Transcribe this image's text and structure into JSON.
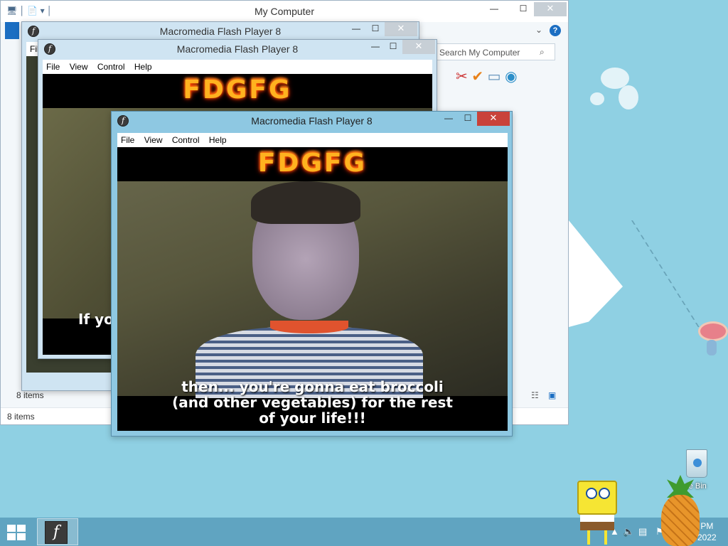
{
  "explorer": {
    "title": "My Computer",
    "search_placeholder": "Search My Computer",
    "status_back": "8 items",
    "status_front": "8 items",
    "nav_label": "Fil"
  },
  "flash_windows": [
    {
      "title": "Macromedia Flash Player 8"
    },
    {
      "title": "Macromedia Flash Player 8",
      "subtitle": "If yo"
    },
    {
      "title": "Macromedia Flash Player 8",
      "subtitle": [
        "then... you're gonna eat broccoli",
        "(and other vegetables) for the rest",
        "of your life!!!"
      ]
    }
  ],
  "menu": {
    "file": "File",
    "view": "View",
    "control": "Control",
    "help": "Help"
  },
  "banner_text": "FDGFG",
  "buttons": {
    "minimize": "—",
    "maximize": "☐",
    "close": "✕"
  },
  "desktop": {
    "recycle_bin_label": "le Bin"
  },
  "taskbar": {
    "time": "7:05 PM",
    "date": "9/13/2022"
  },
  "colors": {
    "active_border": "#8ec8e2",
    "close_active": "#c9423a",
    "desktop": "#8fd0e3"
  }
}
